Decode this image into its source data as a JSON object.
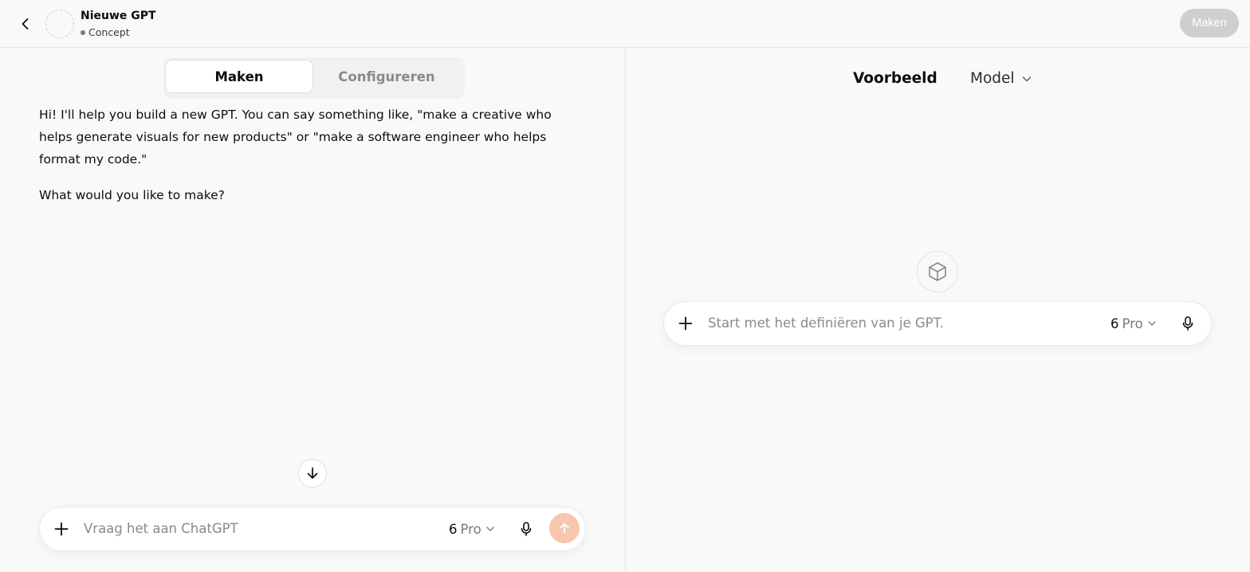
{
  "header": {
    "gpt_name": "Nieuwe GPT",
    "status": "Concept",
    "create_button": "Maken"
  },
  "builder": {
    "tabs": [
      {
        "label": "Maken",
        "active": true
      },
      {
        "label": "Configureren",
        "active": false
      }
    ],
    "messages": [
      "Hi! I'll help you build a new GPT. You can say something like, \"make a creative who helps generate visuals for new products\" or \"make a software engineer who helps format my code.\"",
      "What would you like to make?"
    ],
    "composer": {
      "placeholder": "Vraag het aan ChatGPT",
      "model_number": "6",
      "model_tier": "Pro"
    }
  },
  "preview": {
    "title": "Voorbeeld",
    "model_label": "Model",
    "composer": {
      "placeholder": "Start met het definiëren van je GPT.",
      "model_number": "6",
      "model_tier": "Pro"
    }
  },
  "colors": {
    "background": "#f9f9f9",
    "send_button": "#f6c6ad",
    "disabled_button": "#cfcfcf"
  },
  "icons": [
    "chevron-left-icon",
    "plus-icon",
    "chevron-down-icon",
    "microphone-icon",
    "arrow-up-icon",
    "arrow-down-icon",
    "cube-icon"
  ]
}
